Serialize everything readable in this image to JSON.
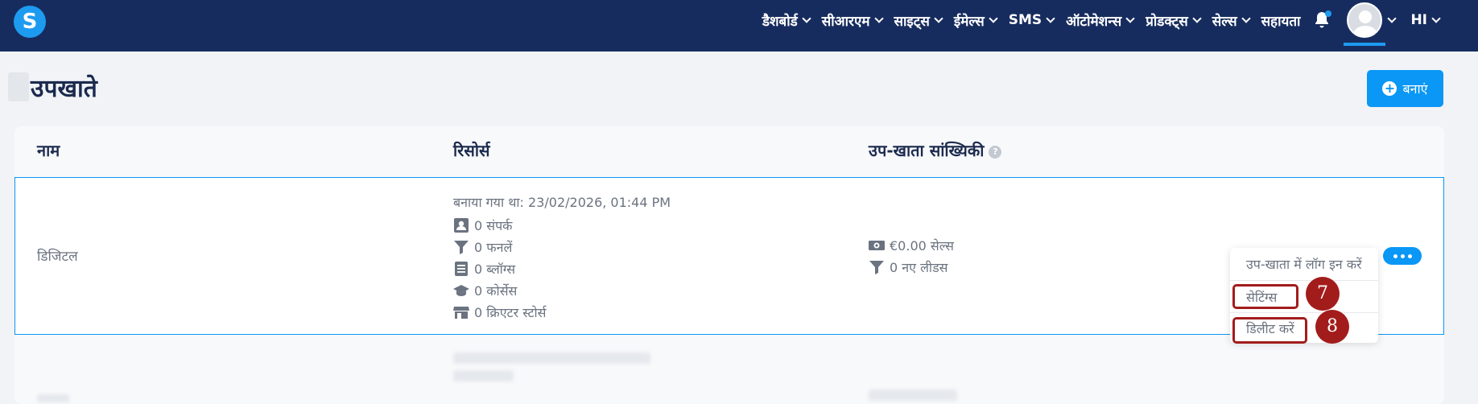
{
  "brand": {
    "logo_letter": "S"
  },
  "nav": {
    "items": [
      {
        "label": "डैशबोर्ड",
        "has_caret": true
      },
      {
        "label": "सीआरएम",
        "has_caret": true
      },
      {
        "label": "साइट्स",
        "has_caret": true
      },
      {
        "label": "ईमेल्स",
        "has_caret": true
      },
      {
        "label": "SMS",
        "has_caret": true
      },
      {
        "label": "ऑटोमेशन्स",
        "has_caret": true
      },
      {
        "label": "प्रोडक्ट्स",
        "has_caret": true
      },
      {
        "label": "सेल्स",
        "has_caret": true
      },
      {
        "label": "सहायता",
        "has_caret": false
      }
    ],
    "language": "HI",
    "notification_icon": "bell-icon"
  },
  "page": {
    "title": "उपखाते",
    "create_button": "बनाएं"
  },
  "table": {
    "headers": {
      "name": "नाम",
      "resources": "रिसोर्स",
      "stats": "उप-खाता सांख्यिकी"
    },
    "rows": [
      {
        "name": "डिजिटल",
        "created": "बनाया गया था: 23/02/2026, 01:44 PM",
        "resources": [
          {
            "icon": "contact-card-icon",
            "label": "0 संपर्क"
          },
          {
            "icon": "funnel-icon",
            "label": "0 फनलें"
          },
          {
            "icon": "document-icon",
            "label": "0 ब्लॉग्स"
          },
          {
            "icon": "graduation-cap-icon",
            "label": "0 कोर्सेस"
          },
          {
            "icon": "storefront-icon",
            "label": "0 क्रिएटर स्टोर्स"
          }
        ],
        "stats": [
          {
            "icon": "money-icon",
            "label": "€0.00 सेल्स"
          },
          {
            "icon": "funnel-icon",
            "label": "0 नए लीडस"
          }
        ]
      }
    ]
  },
  "row_menu": {
    "items": [
      "उप-खाता में लॉग इन करें",
      "सेटिंग्स",
      "डिलीट करें"
    ]
  },
  "annotations": {
    "settings_badge": "7",
    "delete_badge": "8"
  },
  "colors": {
    "nav_bg": "#172c5e",
    "accent": "#0a97f5",
    "annotation_red": "#a31c1c"
  }
}
